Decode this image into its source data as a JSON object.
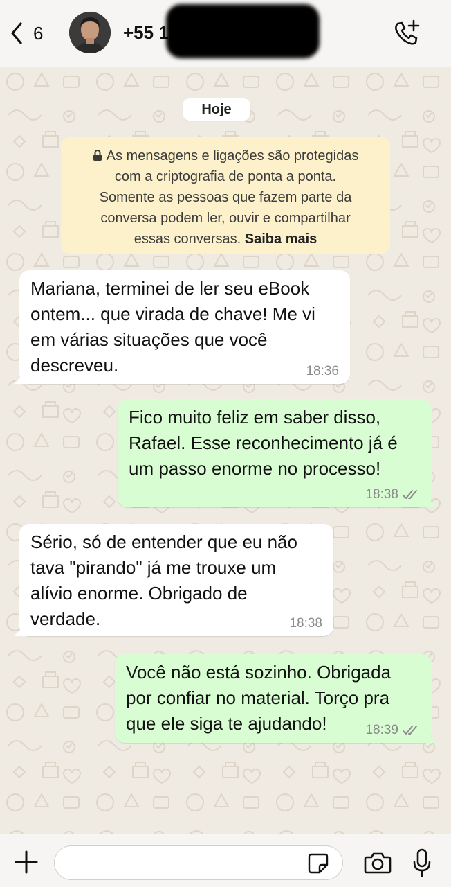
{
  "header": {
    "back_count": "6",
    "contact_name": "+55 11",
    "icons": [
      "chevron-left-icon",
      "avatar",
      "call-add-icon"
    ]
  },
  "chat": {
    "date_label": "Hoje",
    "encryption_notice": {
      "lines": [
        "As mensagens e ligações são protegidas",
        "com a criptografia de ponta a ponta.",
        "Somente as pessoas que fazem parte da",
        "conversa podem ler, ouvir e compartilhar",
        "essas conversas."
      ],
      "link": "Saiba mais"
    },
    "messages": [
      {
        "direction": "incoming",
        "lines": [
          "Mariana, terminei de ler seu eBook",
          "ontem... que virada de chave! Me vi",
          "em várias situações que você",
          "descreveu."
        ],
        "time": "18:36"
      },
      {
        "direction": "outgoing",
        "lines": [
          "Fico muito feliz em saber disso,",
          "Rafael. Esse reconhecimento já é",
          "um passo enorme no processo!"
        ],
        "time": "18:38",
        "status": "read"
      },
      {
        "direction": "incoming",
        "lines": [
          "Sério, só de entender que eu não",
          "tava \"pirando\" já me trouxe um",
          "alívio enorme. Obrigado de",
          "verdade."
        ],
        "time": "18:38"
      },
      {
        "direction": "outgoing",
        "lines": [
          "Você não está sozinho. Obrigada",
          "por confiar no material. Torço pra",
          "que ele siga te ajudando!"
        ],
        "time": "18:39",
        "status": "read"
      }
    ]
  },
  "composer": {
    "input_value": "",
    "icons": [
      "plus-icon",
      "sticker-icon",
      "camera-icon",
      "microphone-icon"
    ]
  },
  "colors": {
    "background": "#efeae2",
    "outgoing_bubble": "#d9fdd3",
    "incoming_bubble": "#ffffff",
    "encryption_notice": "#fdf1cb"
  }
}
